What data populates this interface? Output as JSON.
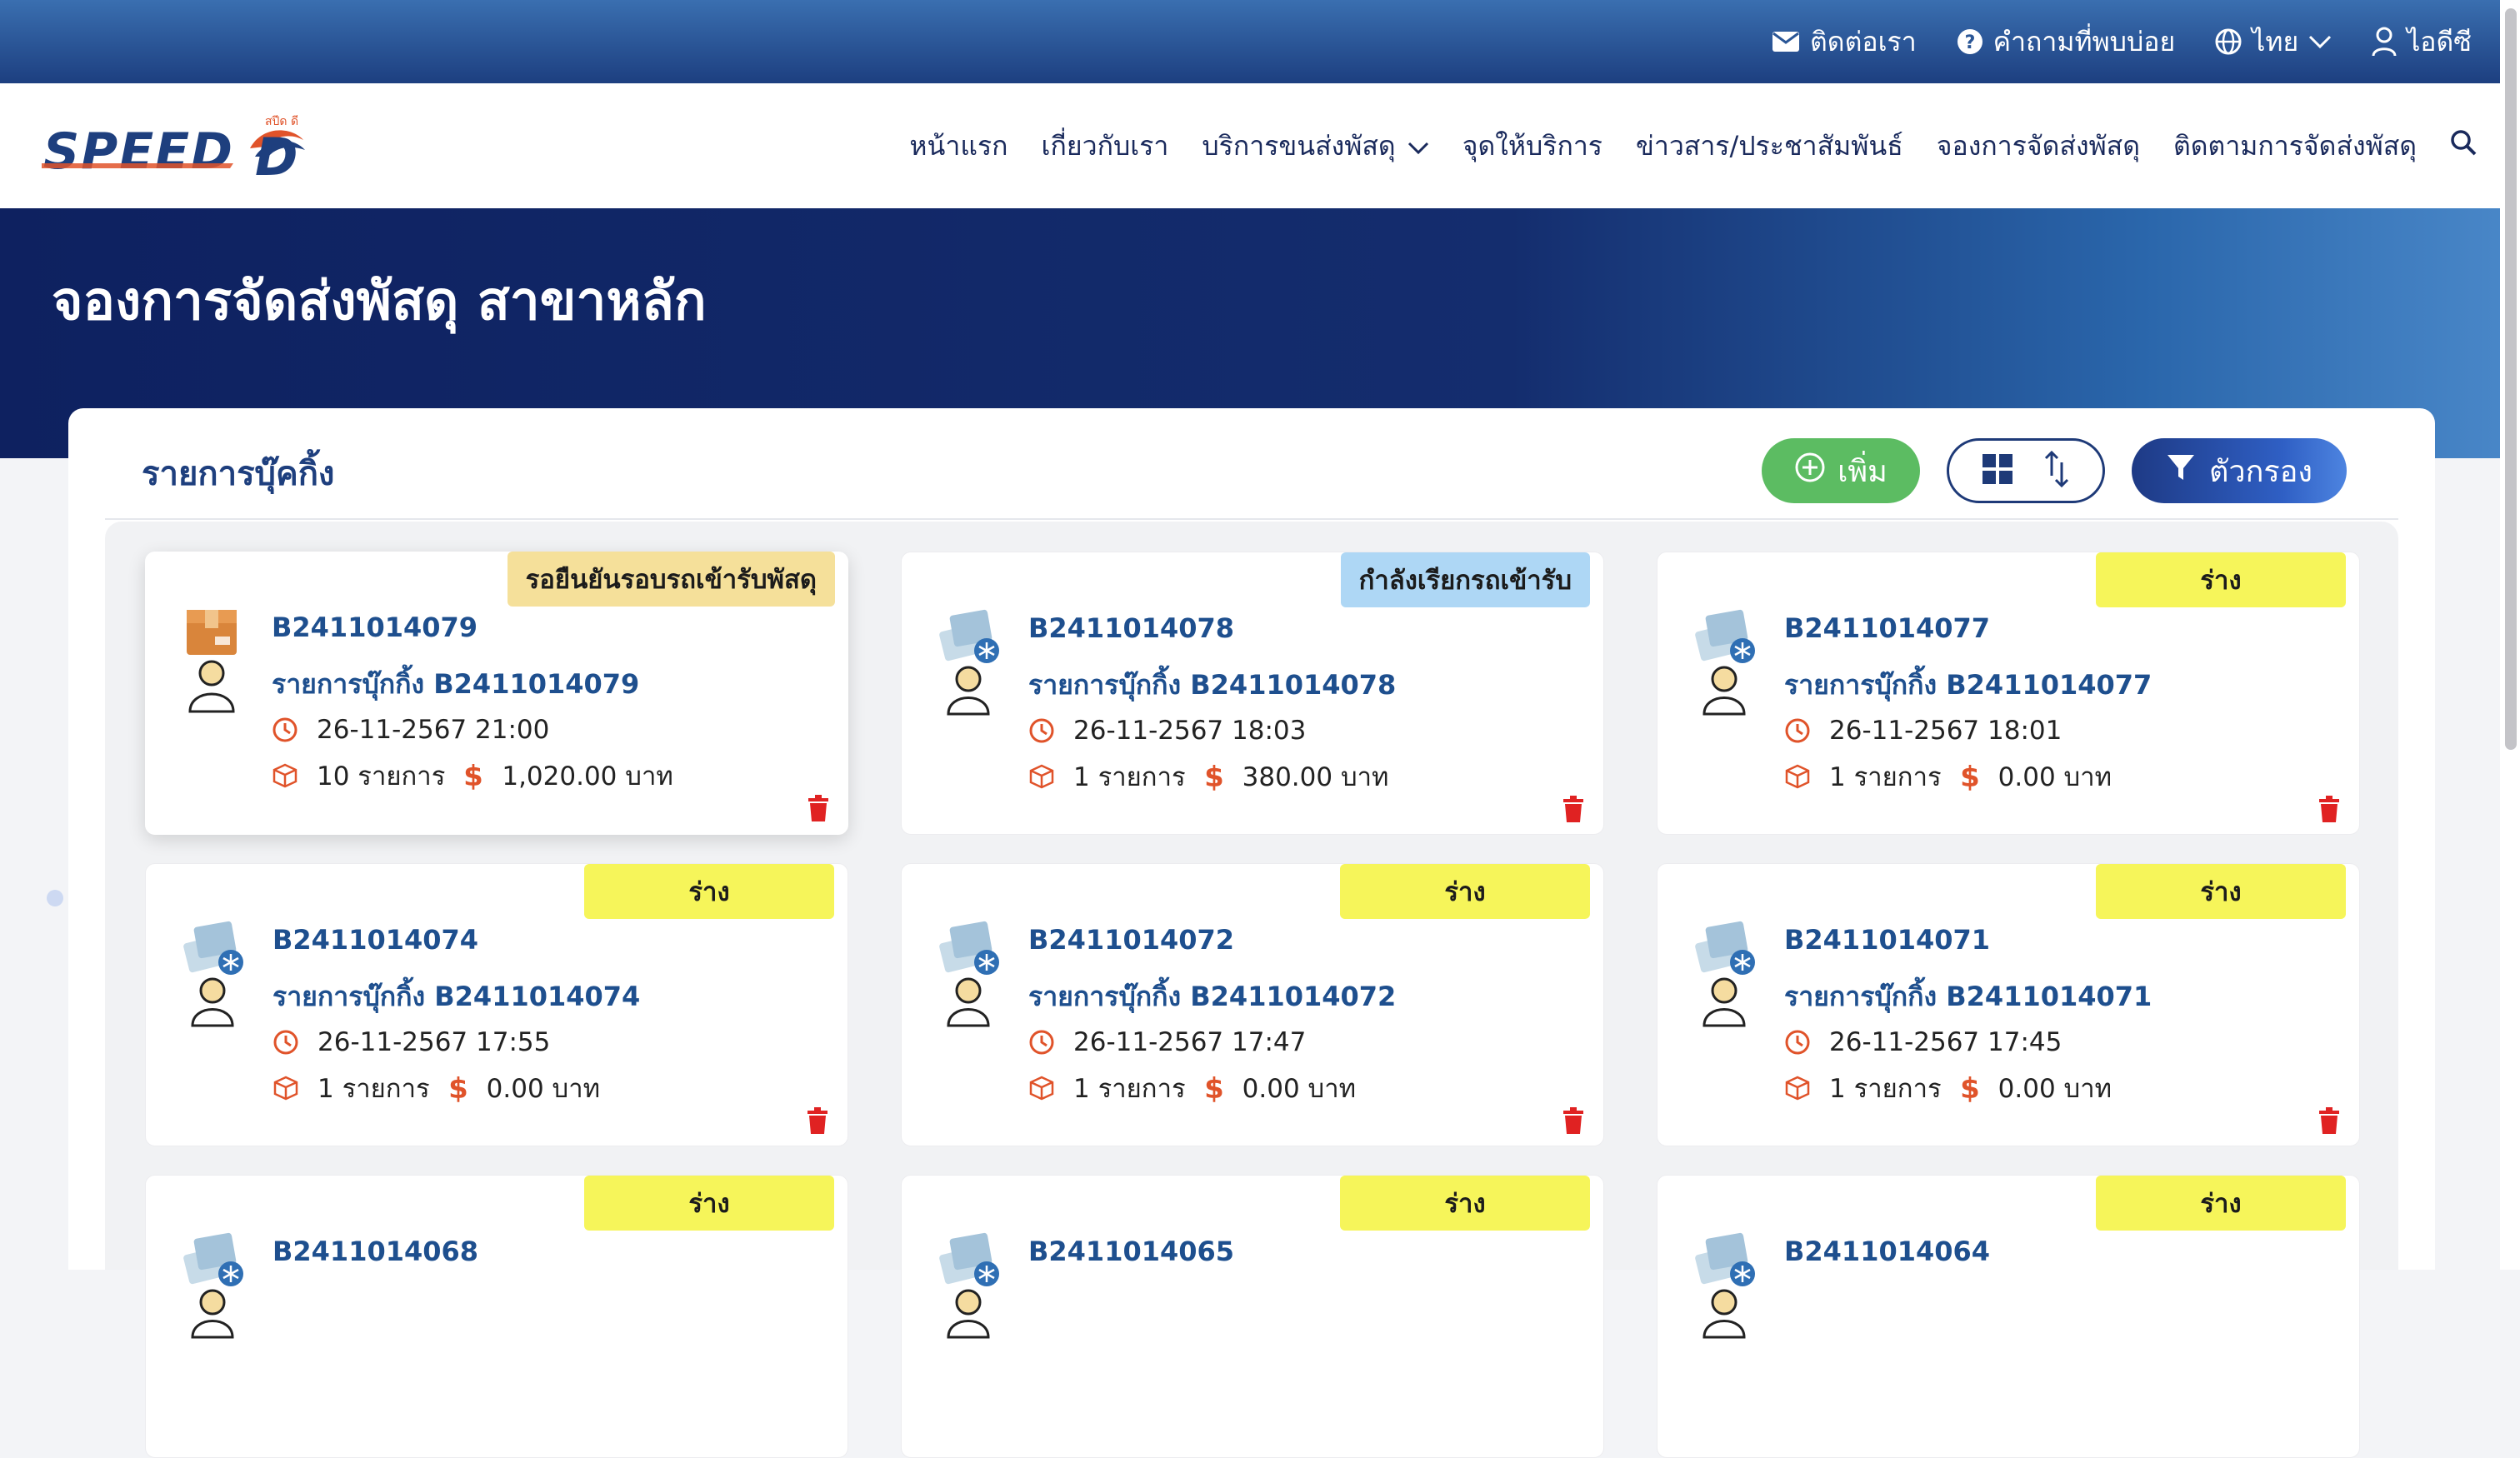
{
  "topbar": {
    "contact": "ติดต่อเรา",
    "faq": "คำถามที่พบบ่อย",
    "language": "ไทย",
    "user": "ไอดีซี"
  },
  "logo": {
    "text": "SPEED",
    "small_text": "สปีด ดี"
  },
  "nav": {
    "items": [
      "หน้าแรก",
      "เกี่ยวกับเรา",
      "บริการขนส่งพัสดุ",
      "จุดให้บริการ",
      "ข่าวสาร/ประชาสัมพันธ์",
      "จองการจัดส่งพัสดุ",
      "ติดตามการจัดส่งพัสดุ"
    ]
  },
  "hero": {
    "title": "จองการจัดส่งพัสดุ สาขาหลัก"
  },
  "panel": {
    "title": "รายการบุ๊คกิ้ง",
    "add_label": "เพิ่ม",
    "filter_label": "ตัวกรอง"
  },
  "colors": {
    "accent_orange": "#e0532a",
    "draft_badge": "#f6f55a",
    "waiting_badge": "#f5e09a",
    "calling_badge": "#aed7f5",
    "add_green": "#5cbc62",
    "navy": "#0e2160"
  },
  "bookings": [
    {
      "status": "รอยืนยันรอบรถเข้ารับพัสดุ",
      "status_type": "waiting",
      "icon": "parcel-box-icon",
      "id": "B2411014079",
      "name": "รายการบุ๊กกิ้ง B2411014079",
      "datetime": "26-11-2567 21:00",
      "items": "10 รายการ",
      "amount": "1,020.00 บาท"
    },
    {
      "status": "กำลังเรียกรถเข้ารับ",
      "status_type": "calling",
      "icon": "parcel-cold-icon",
      "id": "B2411014078",
      "name": "รายการบุ๊กกิ้ง B2411014078",
      "datetime": "26-11-2567 18:03",
      "items": "1 รายการ",
      "amount": "380.00 บาท"
    },
    {
      "status": "ร่าง",
      "status_type": "draft",
      "icon": "parcel-cold-icon",
      "id": "B2411014077",
      "name": "รายการบุ๊กกิ้ง B2411014077",
      "datetime": "26-11-2567 18:01",
      "items": "1 รายการ",
      "amount": "0.00 บาท"
    },
    {
      "status": "ร่าง",
      "status_type": "draft",
      "icon": "parcel-cold-icon",
      "id": "B2411014074",
      "name": "รายการบุ๊กกิ้ง B2411014074",
      "datetime": "26-11-2567 17:55",
      "items": "1 รายการ",
      "amount": "0.00 บาท"
    },
    {
      "status": "ร่าง",
      "status_type": "draft",
      "icon": "parcel-cold-icon",
      "id": "B2411014072",
      "name": "รายการบุ๊กกิ้ง B2411014072",
      "datetime": "26-11-2567 17:47",
      "items": "1 รายการ",
      "amount": "0.00 บาท"
    },
    {
      "status": "ร่าง",
      "status_type": "draft",
      "icon": "parcel-cold-icon",
      "id": "B2411014071",
      "name": "รายการบุ๊กกิ้ง B2411014071",
      "datetime": "26-11-2567 17:45",
      "items": "1 รายการ",
      "amount": "0.00 บาท"
    },
    {
      "status": "ร่าง",
      "status_type": "draft",
      "icon": "parcel-cold-icon",
      "id": "B2411014068"
    },
    {
      "status": "ร่าง",
      "status_type": "draft",
      "icon": "parcel-cold-icon",
      "id": "B2411014065"
    },
    {
      "status": "ร่าง",
      "status_type": "draft",
      "icon": "parcel-cold-icon",
      "id": "B2411014064"
    }
  ]
}
